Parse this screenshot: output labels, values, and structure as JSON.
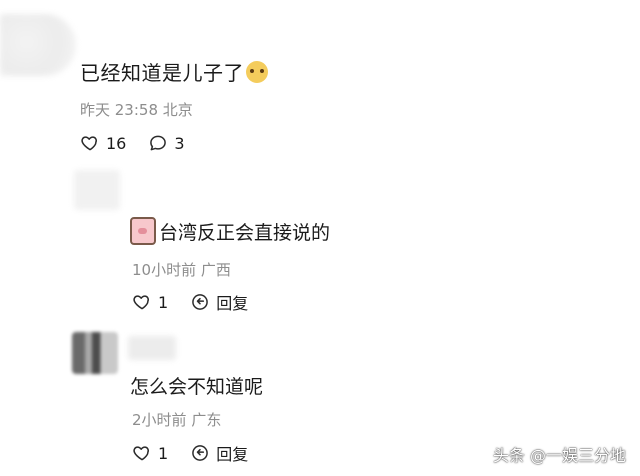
{
  "comment": {
    "text": "已经知道是儿子了",
    "emoji": "smiling-face-emoji",
    "time": "昨天 23:58",
    "location": "北京",
    "likes": "16",
    "replies_count": "3"
  },
  "reply1": {
    "sticker": "pig-sticker",
    "text": "台湾反正会直接说的",
    "time": "10小时前",
    "location": "广西",
    "likes": "1",
    "reply_label": "回复"
  },
  "reply2": {
    "text": "怎么会不知道呢",
    "time": "2小时前",
    "location": "广东",
    "likes": "1",
    "reply_label": "回复"
  },
  "watermark": "头条 @一娱三分地"
}
